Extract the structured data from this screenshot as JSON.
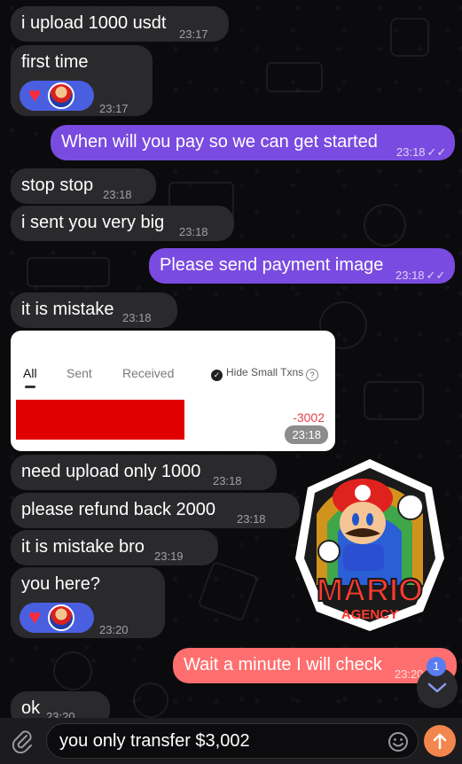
{
  "messages": {
    "m1": {
      "text": "i upload 1000 usdt",
      "time": "23:17"
    },
    "m2": {
      "text": "first time",
      "time": "23:17"
    },
    "m3": {
      "text": "When will you pay so we can get started",
      "time": "23:18"
    },
    "m4": {
      "text": "stop stop",
      "time": "23:18"
    },
    "m5": {
      "text": "i sent you very  big",
      "time": "23:18"
    },
    "m6": {
      "text": "Please send payment image",
      "time": "23:18"
    },
    "m7": {
      "text": "it is mistake",
      "time": "23:18"
    },
    "m8": {
      "text": "need upload only 1000",
      "time": "23:18"
    },
    "m9": {
      "text": "please  refund back 2000",
      "time": "23:18"
    },
    "m10": {
      "text": "it is mistake bro",
      "time": "23:19"
    },
    "m11": {
      "text": "you here?",
      "time": "23:20"
    },
    "m12": {
      "text": "Wait a minute I will check",
      "time": "23:20"
    },
    "m13": {
      "text": "ok",
      "time": "23:20"
    }
  },
  "screenshot_photo": {
    "tabs": [
      "All",
      "Sent",
      "Received"
    ],
    "hide_small": "Hide Small Txns",
    "amount": "-3002",
    "time": "23:18"
  },
  "sticker": {
    "line1": "MARIO",
    "line2": "AGENCY"
  },
  "unread_count": "1",
  "composer": {
    "text": "you only transfer $3,002"
  },
  "colors": {
    "incoming": "#2a2a2d",
    "outgoing": "#7a4be0",
    "outgoing_alt": "#ff6f6f",
    "send": "#f3864e"
  }
}
